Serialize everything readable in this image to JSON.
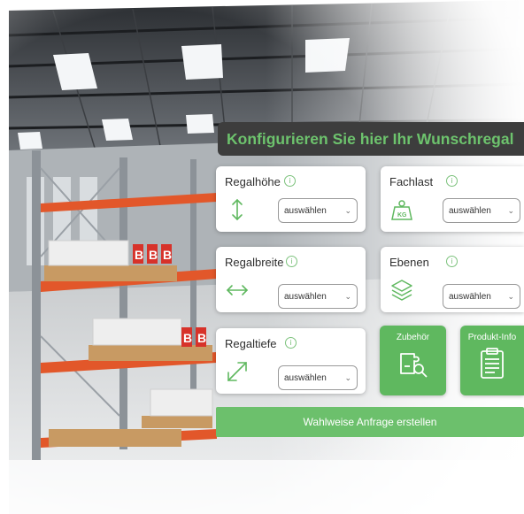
{
  "banner": {
    "title": "Konfigurieren Sie hier Ihr Wunschregal"
  },
  "cards": [
    {
      "label": "Regalhöhe",
      "info": "i",
      "select": "auswählen",
      "icon": "vertical-arrows-icon"
    },
    {
      "label": "Fachlast",
      "info": "i",
      "select": "auswählen",
      "icon": "kg-weight-icon"
    },
    {
      "label": "Regalbreite",
      "info": "i",
      "select": "auswählen",
      "icon": "horizontal-arrows-icon"
    },
    {
      "label": "Ebenen",
      "info": "i",
      "select": "auswählen",
      "icon": "layers-icon"
    },
    {
      "label": "Regaltiefe",
      "info": "i",
      "select": "auswählen",
      "icon": "diagonal-arrows-icon"
    }
  ],
  "buttons": {
    "zubehoer": "Zubehör",
    "produkt_info": "Produkt-Info",
    "cta": "Wahlweise Anfrage erstellen"
  },
  "colors": {
    "accent": "#5fb85f",
    "banner_bg": "#3d3d3d",
    "banner_text": "#6dc36d"
  }
}
